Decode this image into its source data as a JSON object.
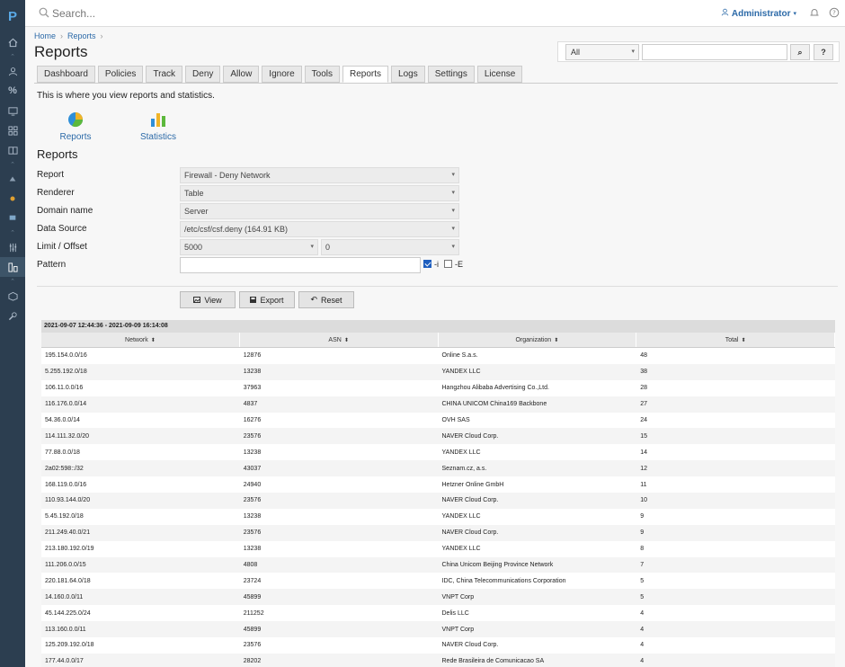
{
  "app": {
    "logo_letter": "P"
  },
  "topbar": {
    "search_placeholder": "Search...",
    "user": "Administrator"
  },
  "sidebar": {
    "icons": [
      "home-icon",
      "user-icon",
      "percent-icon",
      "monitor-icon",
      "grid-icon",
      "book-icon",
      "network-icon",
      "plugin-icon",
      "server-icon",
      "sliders-icon",
      "reports-icon",
      "package-icon",
      "wrench-icon"
    ]
  },
  "breadcrumb": [
    "Home",
    "Reports"
  ],
  "page_title": "Reports",
  "filter": {
    "select_value": "All",
    "search_button": "⌕",
    "help_button": "?"
  },
  "tabs": [
    "Dashboard",
    "Policies",
    "Track",
    "Deny",
    "Allow",
    "Ignore",
    "Tools",
    "Reports",
    "Logs",
    "Settings",
    "License"
  ],
  "active_tab": "Reports",
  "intro": "This is where you view reports and statistics.",
  "links": {
    "reports": "Reports",
    "statistics": "Statistics"
  },
  "form": {
    "section_title": "Reports",
    "report_label": "Report",
    "report_value": "Firewall - Deny Network",
    "renderer_label": "Renderer",
    "renderer_value": "Table",
    "domain_label": "Domain name",
    "domain_value": "Server",
    "source_label": "Data Source",
    "source_value": "/etc/csf/csf.deny (164.91 KB)",
    "limit_label": "Limit / Offset",
    "limit_value": "5000",
    "offset_value": "0",
    "pattern_label": "Pattern",
    "pattern_value": "",
    "opt_i": "-i",
    "opt_E": "-E",
    "opt_i_checked": true,
    "opt_E_checked": false
  },
  "buttons": {
    "view": "View",
    "export": "Export",
    "reset": "Reset"
  },
  "table": {
    "range": "2021-09-07 12:44:36 - 2021-09-09 16:14:08",
    "columns": [
      "Network",
      "ASN",
      "Organization",
      "Total"
    ],
    "rows": [
      [
        "195.154.0.0/16",
        "12876",
        "Online S.a.s.",
        "48"
      ],
      [
        "5.255.192.0/18",
        "13238",
        "YANDEX LLC",
        "38"
      ],
      [
        "106.11.0.0/16",
        "37963",
        "Hangzhou Alibaba Advertising Co.,Ltd.",
        "28"
      ],
      [
        "116.176.0.0/14",
        "4837",
        "CHINA UNICOM China169 Backbone",
        "27"
      ],
      [
        "54.36.0.0/14",
        "16276",
        "OVH SAS",
        "24"
      ],
      [
        "114.111.32.0/20",
        "23576",
        "NAVER Cloud Corp.",
        "15"
      ],
      [
        "77.88.0.0/18",
        "13238",
        "YANDEX LLC",
        "14"
      ],
      [
        "2a02:598::/32",
        "43037",
        "Seznam.cz, a.s.",
        "12"
      ],
      [
        "168.119.0.0/16",
        "24940",
        "Hetzner Online GmbH",
        "11"
      ],
      [
        "110.93.144.0/20",
        "23576",
        "NAVER Cloud Corp.",
        "10"
      ],
      [
        "5.45.192.0/18",
        "13238",
        "YANDEX LLC",
        "9"
      ],
      [
        "211.249.40.0/21",
        "23576",
        "NAVER Cloud Corp.",
        "9"
      ],
      [
        "213.180.192.0/19",
        "13238",
        "YANDEX LLC",
        "8"
      ],
      [
        "111.206.0.0/15",
        "4808",
        "China Unicom Beijing Province Network",
        "7"
      ],
      [
        "220.181.64.0/18",
        "23724",
        "IDC, China Telecommunications Corporation",
        "5"
      ],
      [
        "14.160.0.0/11",
        "45899",
        "VNPT Corp",
        "5"
      ],
      [
        "45.144.225.0/24",
        "211252",
        "Delis LLC",
        "4"
      ],
      [
        "113.160.0.0/11",
        "45899",
        "VNPT Corp",
        "4"
      ],
      [
        "125.209.192.0/18",
        "23576",
        "NAVER Cloud Corp.",
        "4"
      ],
      [
        "177.44.0.0/17",
        "28202",
        "Rede Brasileira de Comunicacao SA",
        "4"
      ]
    ]
  },
  "colors": {
    "sidebar": "#2c3e50",
    "link": "#2c6aa8",
    "checkbox": "#1f5fbf"
  }
}
